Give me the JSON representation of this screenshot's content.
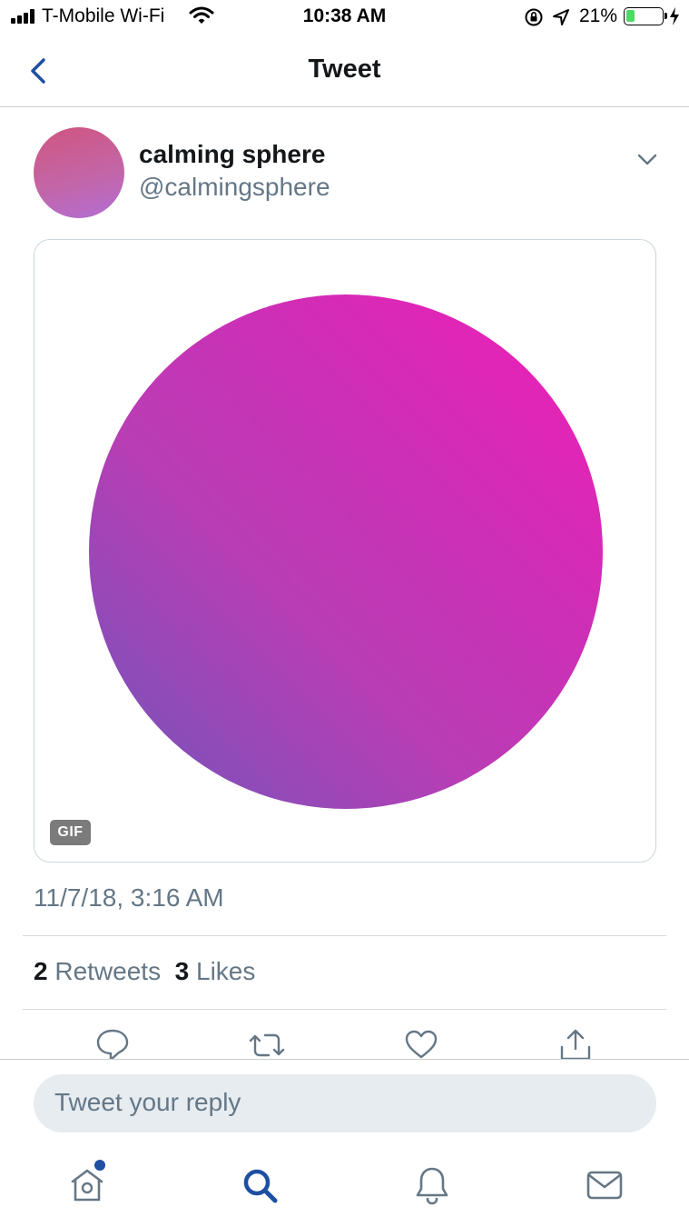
{
  "status_bar": {
    "carrier": "T-Mobile Wi-Fi",
    "time": "10:38 AM",
    "battery_percent": "21%",
    "battery_level": 0.21,
    "icons": [
      "signal-icon",
      "wifi-icon",
      "rotation-lock-icon",
      "location-icon",
      "battery-icon",
      "charging-icon"
    ]
  },
  "nav": {
    "title": "Tweet",
    "back_icon": "back-chevron-icon"
  },
  "tweet": {
    "author_name": "calming sphere",
    "author_handle": "@calmingsphere",
    "menu_icon": "chevron-down-icon",
    "media_badge": "GIF",
    "media_colors": [
      "#f21db6",
      "#cd2fb6",
      "#8a4db8",
      "#6f55bd"
    ],
    "timestamp": "11/7/18, 3:16 AM",
    "retweet_count": "2",
    "retweet_label": "Retweets",
    "like_count": "3",
    "like_label": "Likes"
  },
  "actions": [
    "reply-icon",
    "retweet-icon",
    "like-icon",
    "share-icon"
  ],
  "reply": {
    "placeholder": "Tweet your reply"
  },
  "tab_bar": {
    "items": [
      "home-icon",
      "search-icon",
      "notifications-icon",
      "messages-icon"
    ],
    "active": "search-icon",
    "accent": "#1d4fa3"
  }
}
